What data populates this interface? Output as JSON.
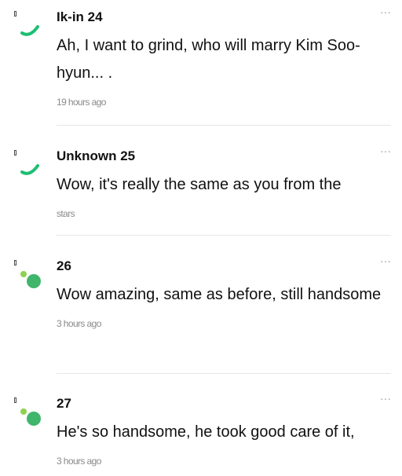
{
  "more_icon_glyph": "···",
  "colors": {
    "accent_green": "#1dbf73",
    "dot_light_green": "#8fd14f",
    "dot_green": "#3fb66b"
  },
  "comments": [
    {
      "author": "Ik-in 24",
      "text": "Ah, I want to grind, who will marry Kim Soo-hyun... .",
      "time": "19 hours ago",
      "avatar": "green-arc-icon"
    },
    {
      "author": "Unknown 25",
      "text": "Wow, it's really the same as you from the",
      "time": "stars",
      "avatar": "green-arc-icon"
    },
    {
      "author": "26",
      "text": "Wow amazing, same as before, still handsome",
      "time": "3 hours ago",
      "avatar": "green-dots-icon"
    },
    {
      "author": "27",
      "text": "He's so handsome, he took good care of it,",
      "time": "3 hours ago",
      "avatar": "green-dots-icon"
    }
  ]
}
